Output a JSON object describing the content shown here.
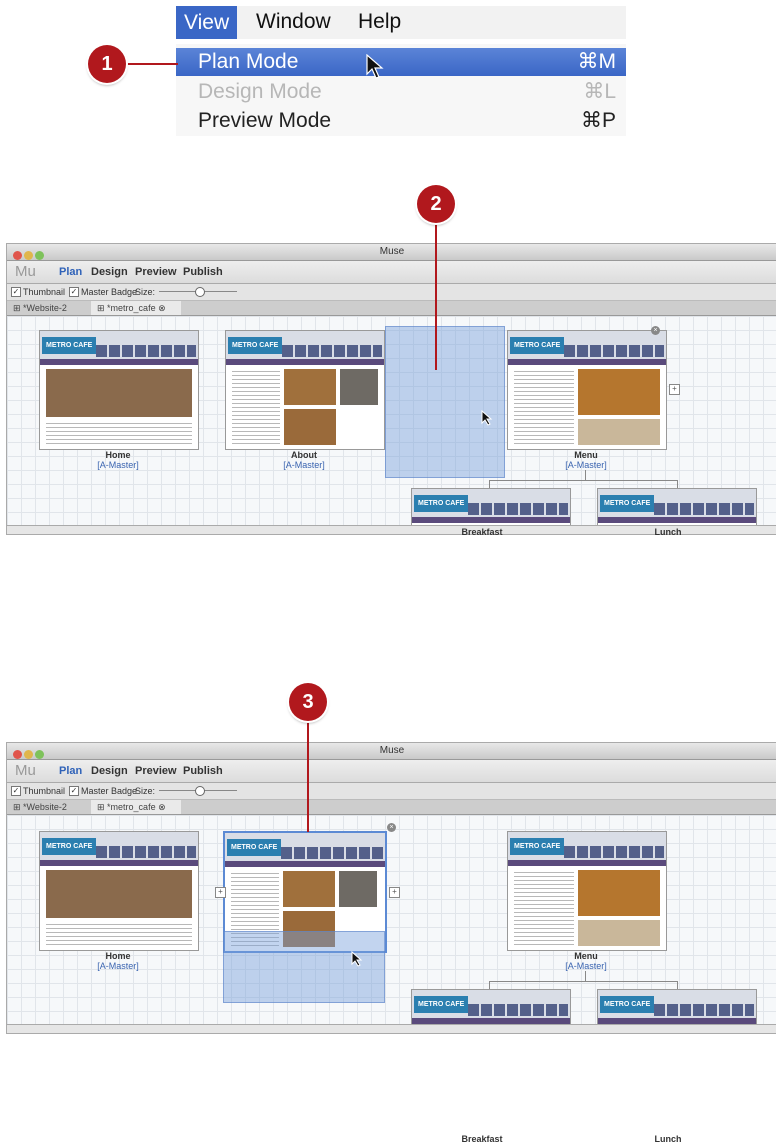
{
  "menu": {
    "bar": [
      "View",
      "Window",
      "Help"
    ],
    "items": [
      {
        "label": "Plan Mode",
        "shortcut": "⌘M",
        "state": "selected"
      },
      {
        "label": "Design Mode",
        "shortcut": "⌘L",
        "state": "disabled"
      },
      {
        "label": "Preview Mode",
        "shortcut": "⌘P",
        "state": "normal"
      }
    ]
  },
  "callouts": [
    "1",
    "2",
    "3"
  ],
  "window": {
    "title": "Muse",
    "logo": "Mu",
    "tabs": [
      "Plan",
      "Design",
      "Preview",
      "Publish"
    ],
    "thumbnail_label": "Thumbnail",
    "master_badge_label": "Master Badge",
    "size_label": "Size:",
    "doc_tabs": [
      "*Website-2",
      "*metro_cafe"
    ]
  },
  "pages": {
    "brand": "METRO CAFE",
    "master": "[A-Master]",
    "home": "Home",
    "about": "About",
    "menu": "Menu",
    "breakfast": "Breakfast",
    "lunch": "Lunch"
  },
  "colors": {
    "callout": "#b1181d",
    "menu_highlight": "#3a66c6",
    "plan_tab": "#2f62b8",
    "brand": "#2b7fb0"
  }
}
